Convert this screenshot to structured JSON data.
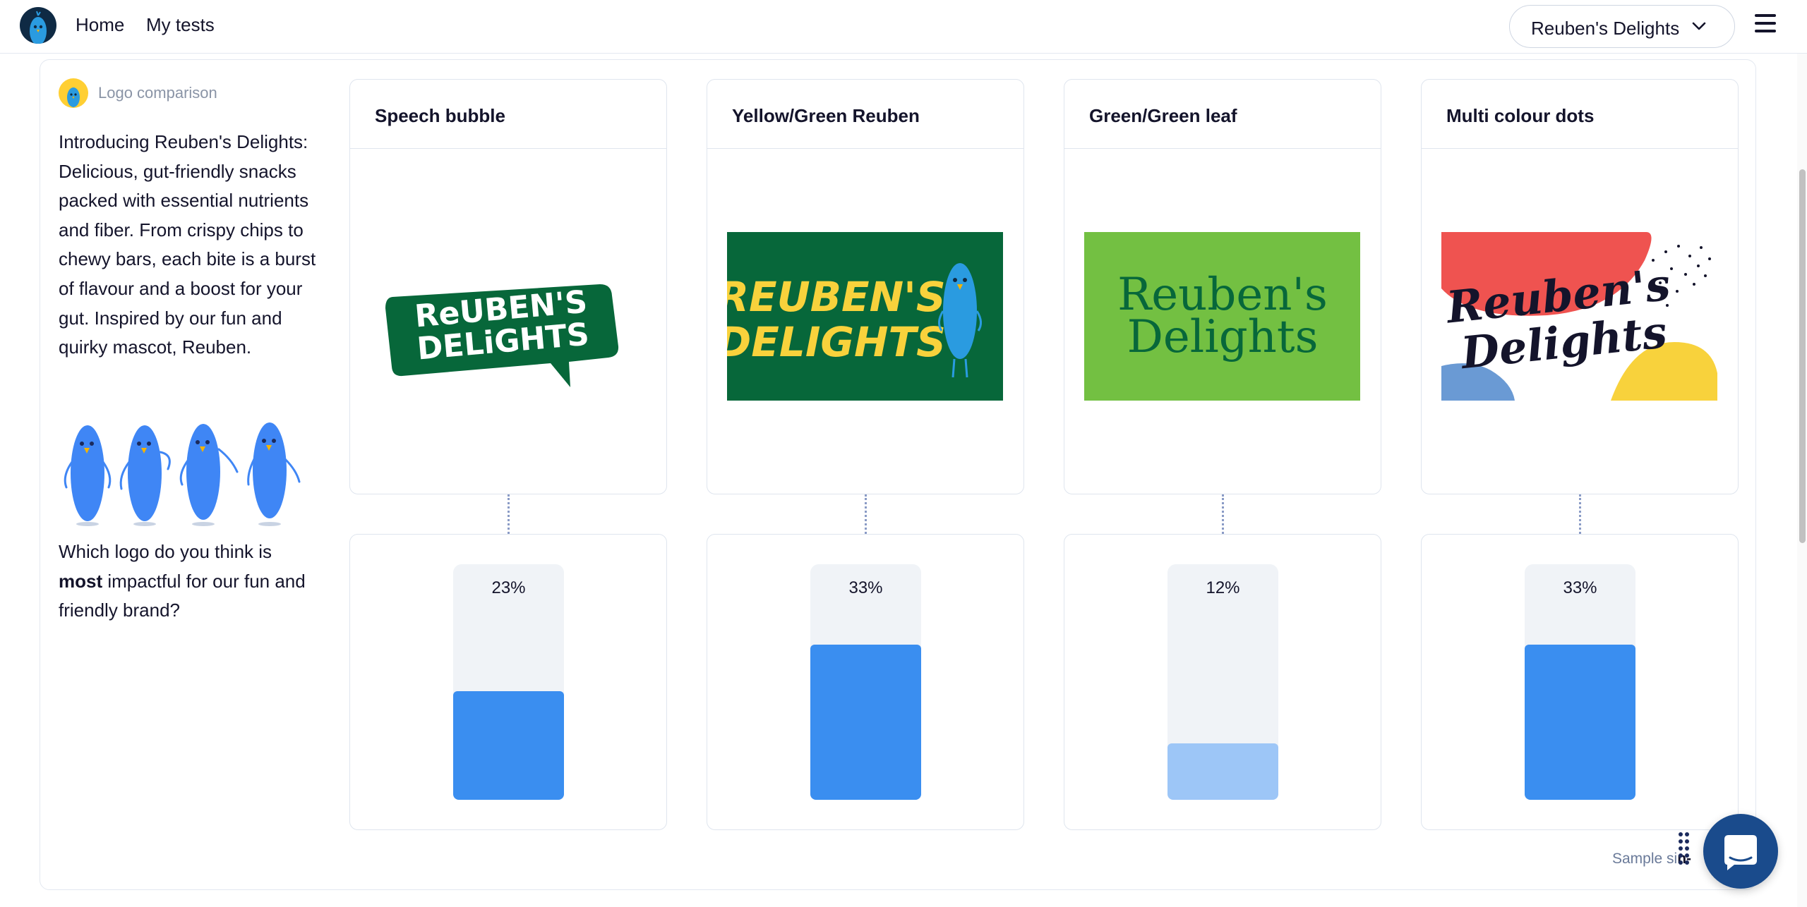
{
  "nav": {
    "home_label": "Home",
    "tests_label": "My tests",
    "project_selector_value": "Reuben's Delights"
  },
  "question": {
    "type_label": "Logo comparison",
    "intro": "Introducing Reuben's Delights: Delicious, gut-friendly snacks packed with essential nutrients and fiber. From crispy chips to chewy bars, each bite is a burst of flavour and a boost for your gut. Inspired by our fun and quirky mascot, Reuben.",
    "prompt_before": "Which logo do you think is ",
    "prompt_bold": "most",
    "prompt_after": " impactful for our fun and friendly brand?"
  },
  "options": [
    {
      "title": "Speech bubble",
      "logo_text_1": "ReUBEN'S",
      "logo_text_2": "DELiGHTS",
      "percent_label": "23%",
      "percent": 23
    },
    {
      "title": "Yellow/Green Reuben",
      "logo_text_1": "REUBEN'S",
      "logo_text_2": "DELIGHTS",
      "percent_label": "33%",
      "percent": 33
    },
    {
      "title": "Green/Green leaf",
      "logo_text_1": "Reuben's",
      "logo_text_2": "Delights",
      "percent_label": "12%",
      "percent": 12
    },
    {
      "title": "Multi colour dots",
      "logo_text_1": "Reuben's",
      "logo_text_2": "Delights",
      "percent_label": "33%",
      "percent": 33
    }
  ],
  "footer": {
    "sample_size_prefix": "Sample si",
    "sample_size_bold": "n-"
  },
  "colors": {
    "bar_fill": "#3a8ef0",
    "bar_fill_lowest": "#9dc6f7",
    "bar_track": "#f0f3f7",
    "logo_dark_green": "#07673a",
    "logo_lime": "#73c042",
    "logo_yellow": "#f8d23c",
    "mascot_blue": "#3f86f5"
  },
  "icons": {
    "brand_avatar": "bird-mascot-icon",
    "question_type": "bird-mascot-icon",
    "project_select": "chevron-down-icon",
    "menu": "hamburger-menu-icon",
    "chat": "chat-bubble-icon",
    "drag": "drag-handle-icon"
  }
}
